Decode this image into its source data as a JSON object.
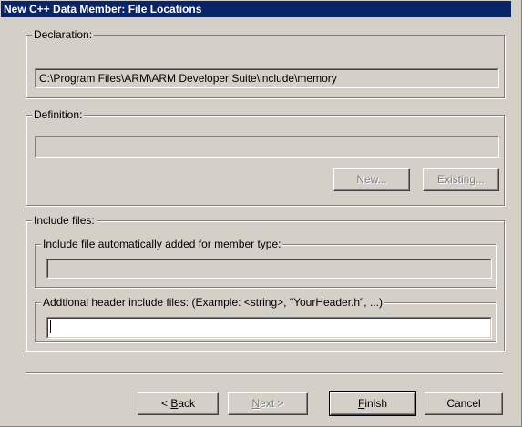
{
  "window": {
    "title": "New C++ Data Member: File Locations"
  },
  "declaration": {
    "label": "Declaration:",
    "path": "C:\\Program Files\\ARM\\ARM Developer Suite\\include\\memory"
  },
  "definition": {
    "label": "Definition:",
    "path": "",
    "new_label": "New...",
    "existing_label": "Existing..."
  },
  "include_files": {
    "label": "Include files:",
    "auto_label": "Include file automatically added for member type:",
    "auto_value": "",
    "additional_label": "Addtional header include files: (Example: <string>, \"YourHeader.h\", ...)",
    "additional_value": ""
  },
  "buttons": {
    "back_prefix": "< ",
    "back_key": "B",
    "back_rest": "ack",
    "next_key": "N",
    "next_rest": "ext >",
    "finish_key": "F",
    "finish_rest": "inish",
    "cancel": "Cancel"
  }
}
